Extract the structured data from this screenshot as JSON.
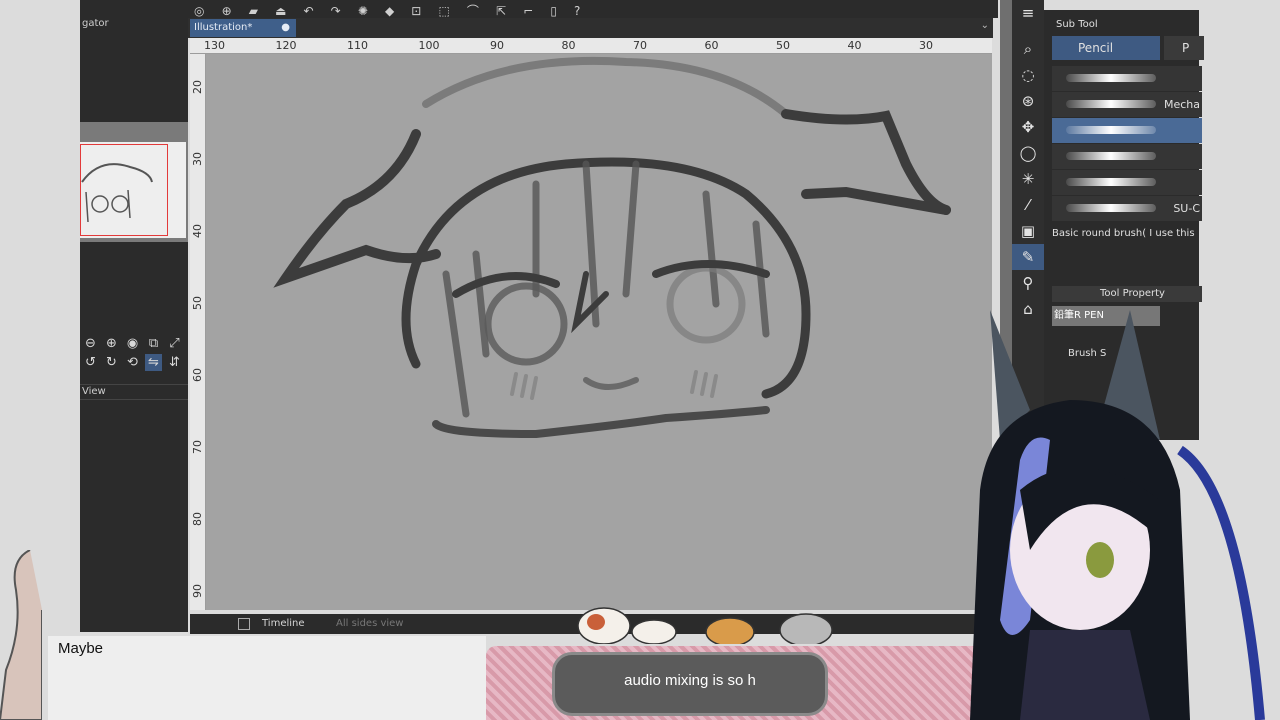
{
  "navigator": {
    "title": "gator",
    "view_label": "View"
  },
  "document": {
    "tab_label": "Illustration*",
    "tab_close": "●"
  },
  "ruler": {
    "top_ticks": [
      "130",
      "120",
      "110",
      "100",
      "90",
      "80",
      "70",
      "60",
      "50",
      "40",
      "30"
    ],
    "left_ticks": [
      "20",
      "30",
      "40",
      "50",
      "60",
      "70",
      "80",
      "90"
    ]
  },
  "timeline": {
    "label": "Timeline",
    "all_sides": "All sides view"
  },
  "subtool": {
    "header": "Sub Tool",
    "tab_active": "Pencil",
    "tab_other": "P",
    "brushes": [
      {
        "name": ""
      },
      {
        "name": "Mecha"
      },
      {
        "name": ""
      },
      {
        "name": ""
      },
      {
        "name": ""
      },
      {
        "name": "SU-C"
      }
    ],
    "brush_description": "Basic round brush( I use this"
  },
  "tool_property": {
    "header": "Tool Property",
    "preset_name": "鉛筆R PEN",
    "brush_size_label": "Brush S"
  },
  "overlay": {
    "subtitle_left": "Maybe",
    "subtitle_bubble": "audio mixing is so h"
  },
  "colors": {
    "accent_blue": "#3e5a82",
    "panel_dark": "#2b2b2b",
    "canvas_gray": "#a3a3a3"
  }
}
